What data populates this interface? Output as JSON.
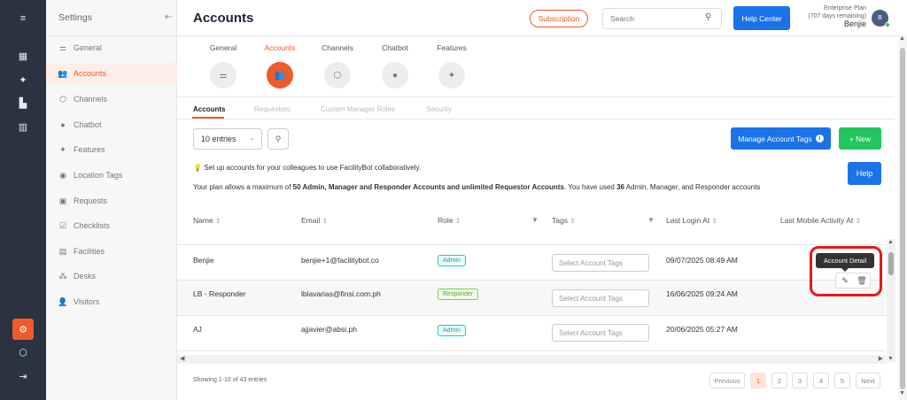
{
  "rail": {
    "icons": [
      "menu-expand-icon",
      "dashboard-icon",
      "pin-icon",
      "bar-chart-icon",
      "analytics-icon",
      "settings-icon",
      "cube-icon",
      "logout-icon"
    ]
  },
  "sidebar": {
    "title": "Settings",
    "items": [
      {
        "label": "General",
        "icon": "sliders-icon"
      },
      {
        "label": "Accounts",
        "icon": "users-icon"
      },
      {
        "label": "Channels",
        "icon": "cube-icon"
      },
      {
        "label": "Chatbot",
        "icon": "chat-icon"
      },
      {
        "label": "Features",
        "icon": "pin-icon"
      },
      {
        "label": "Location Tags",
        "icon": "location-icon"
      },
      {
        "label": "Requests",
        "icon": "requests-icon"
      },
      {
        "label": "Checklists",
        "icon": "checklist-icon"
      },
      {
        "label": "Facilities",
        "icon": "building-icon"
      },
      {
        "label": "Desks",
        "icon": "desk-icon"
      },
      {
        "label": "Visitors",
        "icon": "visitor-icon"
      }
    ]
  },
  "header": {
    "title": "Accounts",
    "subscription_label": "Subscription",
    "search_placeholder": "Search",
    "help_center_label": "Help Center",
    "plan_name": "Enterprise Plan",
    "plan_remaining": "(707 days remaining)",
    "user_name": "Benjie",
    "avatar_initial": "B"
  },
  "categories": [
    {
      "label": "General"
    },
    {
      "label": "Accounts"
    },
    {
      "label": "Channels"
    },
    {
      "label": "Chatbot"
    },
    {
      "label": "Features"
    }
  ],
  "subtabs": [
    "Accounts",
    "Requestors",
    "Custom Manager Roles",
    "Security"
  ],
  "controls": {
    "entries_label": "10 entries",
    "manage_tags_label": "Manage Account Tags",
    "new_label": "+ New",
    "help_label": "Help"
  },
  "notice": {
    "line1": "Set up accounts for your colleagues to use FacilityBot collaboratively.",
    "line2_prefix": "Your plan allows a maximum of ",
    "line2_bold": "50 Admin, Manager and Responder Accounts and unlimited Requestor Accounts",
    "line2_mid": ". You have used ",
    "line2_count": "36",
    "line2_suffix": " Admin, Manager, and Responder accounts"
  },
  "table": {
    "columns": [
      "Name",
      "Email",
      "Role",
      "Tags",
      "Last Login At",
      "Last Mobile Activity At"
    ],
    "tags_placeholder": "Select Account Tags",
    "rows": [
      {
        "name": "Benjie",
        "email": "benjie+1@facilitybot.co",
        "role": "Admin",
        "last_login": "09/07/2025 08:49 AM",
        "last_mobile": ""
      },
      {
        "name": "LB - Responder",
        "email": "lblavarias@finsi.com.ph",
        "role": "Responder",
        "last_login": "16/06/2025 09:24 AM",
        "last_mobile": ""
      },
      {
        "name": "AJ",
        "email": "ajjavier@absi.ph",
        "role": "Admin",
        "last_login": "20/06/2025 05:27 AM",
        "last_mobile": ""
      }
    ],
    "tooltip": "Account Detail"
  },
  "footer": {
    "showing": "Showing 1-10 of 43 entries",
    "previous": "Previous",
    "pages": [
      "1",
      "2",
      "3",
      "4",
      "5"
    ],
    "next": "Next",
    "current_page": "1"
  },
  "colors": {
    "accent": "#f0592a",
    "primary": "#1a73e8",
    "success": "#22c55e",
    "rail": "#2b3340"
  }
}
